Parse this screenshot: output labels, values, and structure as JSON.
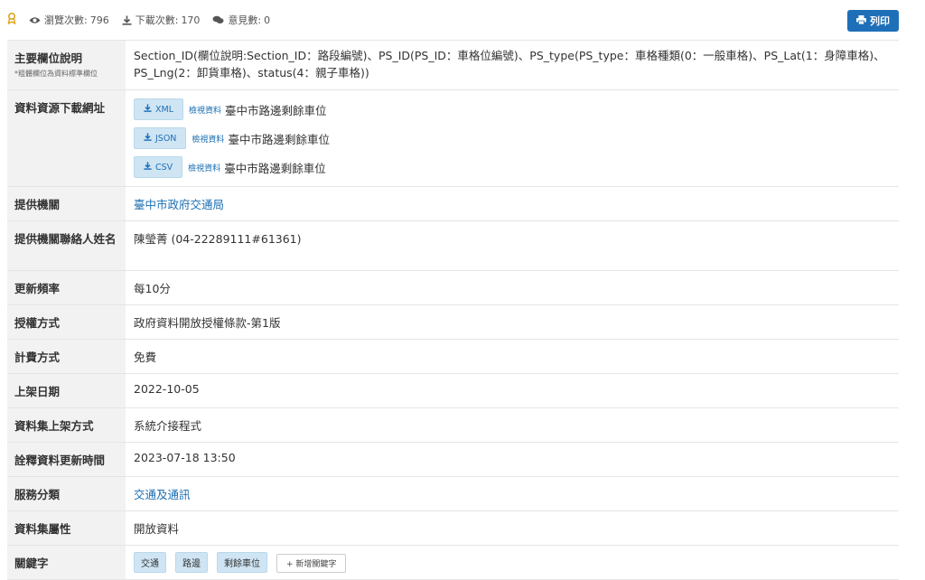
{
  "header": {
    "views_label": "瀏覽次數:",
    "views": "796",
    "downloads_label": "下載次數:",
    "downloads": "170",
    "comments_label": "意見數:",
    "comments": "0",
    "print_label": "列印"
  },
  "rows": {
    "main_fields": {
      "label": "主要欄位說明",
      "sublabel": "*粗體欄位為資料標準欄位",
      "value": "Section_ID(欄位說明:Section_ID：路段編號)、PS_ID(PS_ID：車格位編號)、PS_type(PS_type：車格種類(0：一般車格)、PS_Lat(1：身障車格)、PS_Lng(2：卸貨車格)、status(4：親子車格))"
    },
    "download": {
      "label": "資料資源下載網址",
      "items": [
        {
          "format": "XML",
          "view": "檢視資料",
          "name": "臺中市路邊剩餘車位"
        },
        {
          "format": "JSON",
          "view": "檢視資料",
          "name": "臺中市路邊剩餘車位"
        },
        {
          "format": "CSV",
          "view": "檢視資料",
          "name": "臺中市路邊剩餘車位"
        }
      ]
    },
    "provider": {
      "label": "提供機關",
      "value": "臺中市政府交通局"
    },
    "contact": {
      "label": "提供機關聯絡人姓名",
      "value": "陳瑩菁 (04-22289111#61361)"
    },
    "frequency": {
      "label": "更新頻率",
      "value": "每10分"
    },
    "license": {
      "label": "授權方式",
      "value": "政府資料開放授權條款-第1版"
    },
    "fee": {
      "label": "計費方式",
      "value": "免費"
    },
    "release_date": {
      "label": "上架日期",
      "value": "2022-10-05"
    },
    "release_method": {
      "label": "資料集上架方式",
      "value": "系統介接程式"
    },
    "metadata_updated": {
      "label": "詮釋資料更新時間",
      "value": "2023-07-18 13:50"
    },
    "service_category": {
      "label": "服務分類",
      "value": "交通及通訊"
    },
    "dataset_type": {
      "label": "資料集屬性",
      "value": "開放資料"
    },
    "keywords": {
      "label": "關鍵字",
      "tags": [
        "交通",
        "路邊",
        "剩餘車位"
      ],
      "add_label": "+ 新增關鍵字"
    }
  }
}
